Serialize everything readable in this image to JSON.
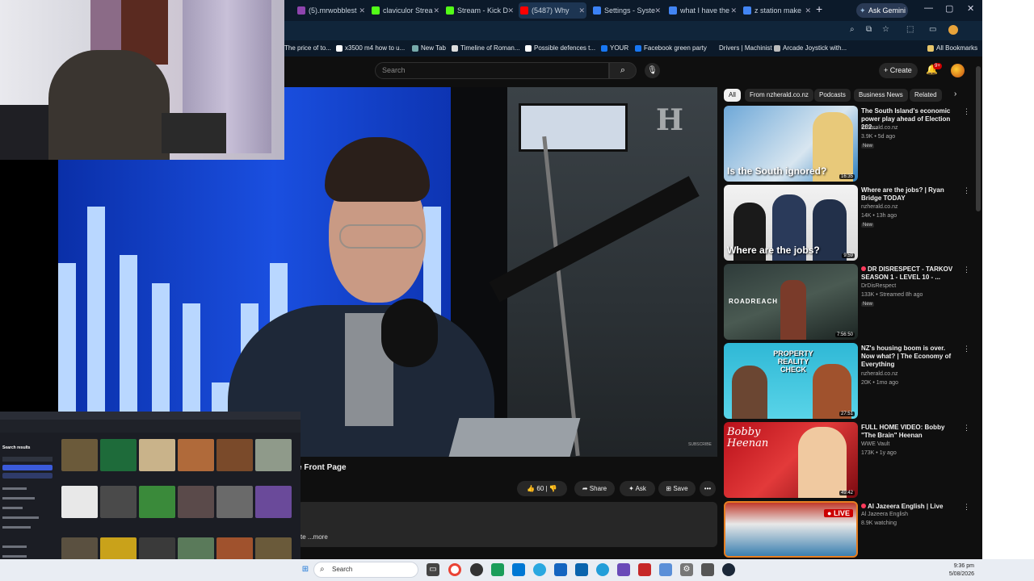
{
  "browser": {
    "tabs": [
      {
        "label": "(5).mrwobblest",
        "color": "#8e44ad"
      },
      {
        "label": "claviculor Strea",
        "color": "#53fc18"
      },
      {
        "label": "Stream - Kick D",
        "color": "#53fc18"
      },
      {
        "label": "(5487) Why",
        "color": "#ff0000"
      },
      {
        "label": "Settings - Syste",
        "color": "#3b82f6"
      },
      {
        "label": "what I have the",
        "color": "#4285f4"
      },
      {
        "label": "z station make",
        "color": "#4285f4"
      }
    ],
    "gemini_label": "Ask Gemini",
    "bookmarks": [
      "The price of to...",
      "x3500 m4 how to u...",
      "New Tab",
      "Timeline of Roman...",
      "Possible defences t...",
      "YOUR",
      "Facebook green party",
      "Drivers | Machinist",
      "Arcade Joystick with..."
    ],
    "all_bookmarks": "All Bookmarks"
  },
  "youtube": {
    "search_placeholder": "Search",
    "create_label": "Create",
    "bell_badge": "9+",
    "video_title_fragment": "e Front Page",
    "likes": "60",
    "share_label": "Share",
    "ask_label": "Ask",
    "save_label": "Save",
    "desc_more": "te ...more",
    "chips": [
      "All",
      "From nzherald.co.nz",
      "Podcasts",
      "Business News",
      "Related"
    ],
    "recommendations": [
      {
        "title": "The South Island's economic power play ahead of Election 202...",
        "channel": "nzherald.co.nz",
        "meta": "3.9K • 5d ago",
        "new": "New",
        "thumb_text": "Is the South ignored?",
        "duration": "16:35",
        "live": false
      },
      {
        "title": "Where are the jobs? | Ryan Bridge TODAY",
        "channel": "nzherald.co.nz",
        "meta": "14K • 13h ago",
        "new": "New",
        "thumb_text": "Where are the jobs?",
        "duration": "9:59",
        "live": false
      },
      {
        "title": "DR DISRESPECT - TARKOV SEASON 1 - LEVEL 10 - ...",
        "channel": "DrDisRespect",
        "meta": "133K • Streamed 8h ago",
        "new": "New",
        "thumb_text": "ROADREACH",
        "duration": "7:56:50",
        "live": false
      },
      {
        "title": "NZ's housing boom is over. Now what? | The Economy of Everything",
        "channel": "nzherald.co.nz",
        "meta": "20K • 1mo ago",
        "new": "",
        "thumb_text": "PROPERTY REALITY CHECK",
        "duration": "27:51",
        "live": false
      },
      {
        "title": "FULL HOME VIDEO: Bobby \"The Brain\" Heenan",
        "channel": "WWE Vault",
        "meta": "173K • 1y ago",
        "new": "",
        "thumb_text": "Bobby Heenan",
        "duration": "49:42",
        "live": false
      },
      {
        "title": "Al Jazeera English | Live",
        "channel": "Al Jazeera English",
        "meta": "8.9K watching",
        "new": "",
        "thumb_text": "LIVE",
        "duration": "",
        "live": true
      }
    ]
  },
  "mini_browser": {
    "heading": "Search results"
  },
  "taskbar": {
    "search_label": "Search",
    "time": "9:36 pm",
    "date": "5/08/2026"
  }
}
